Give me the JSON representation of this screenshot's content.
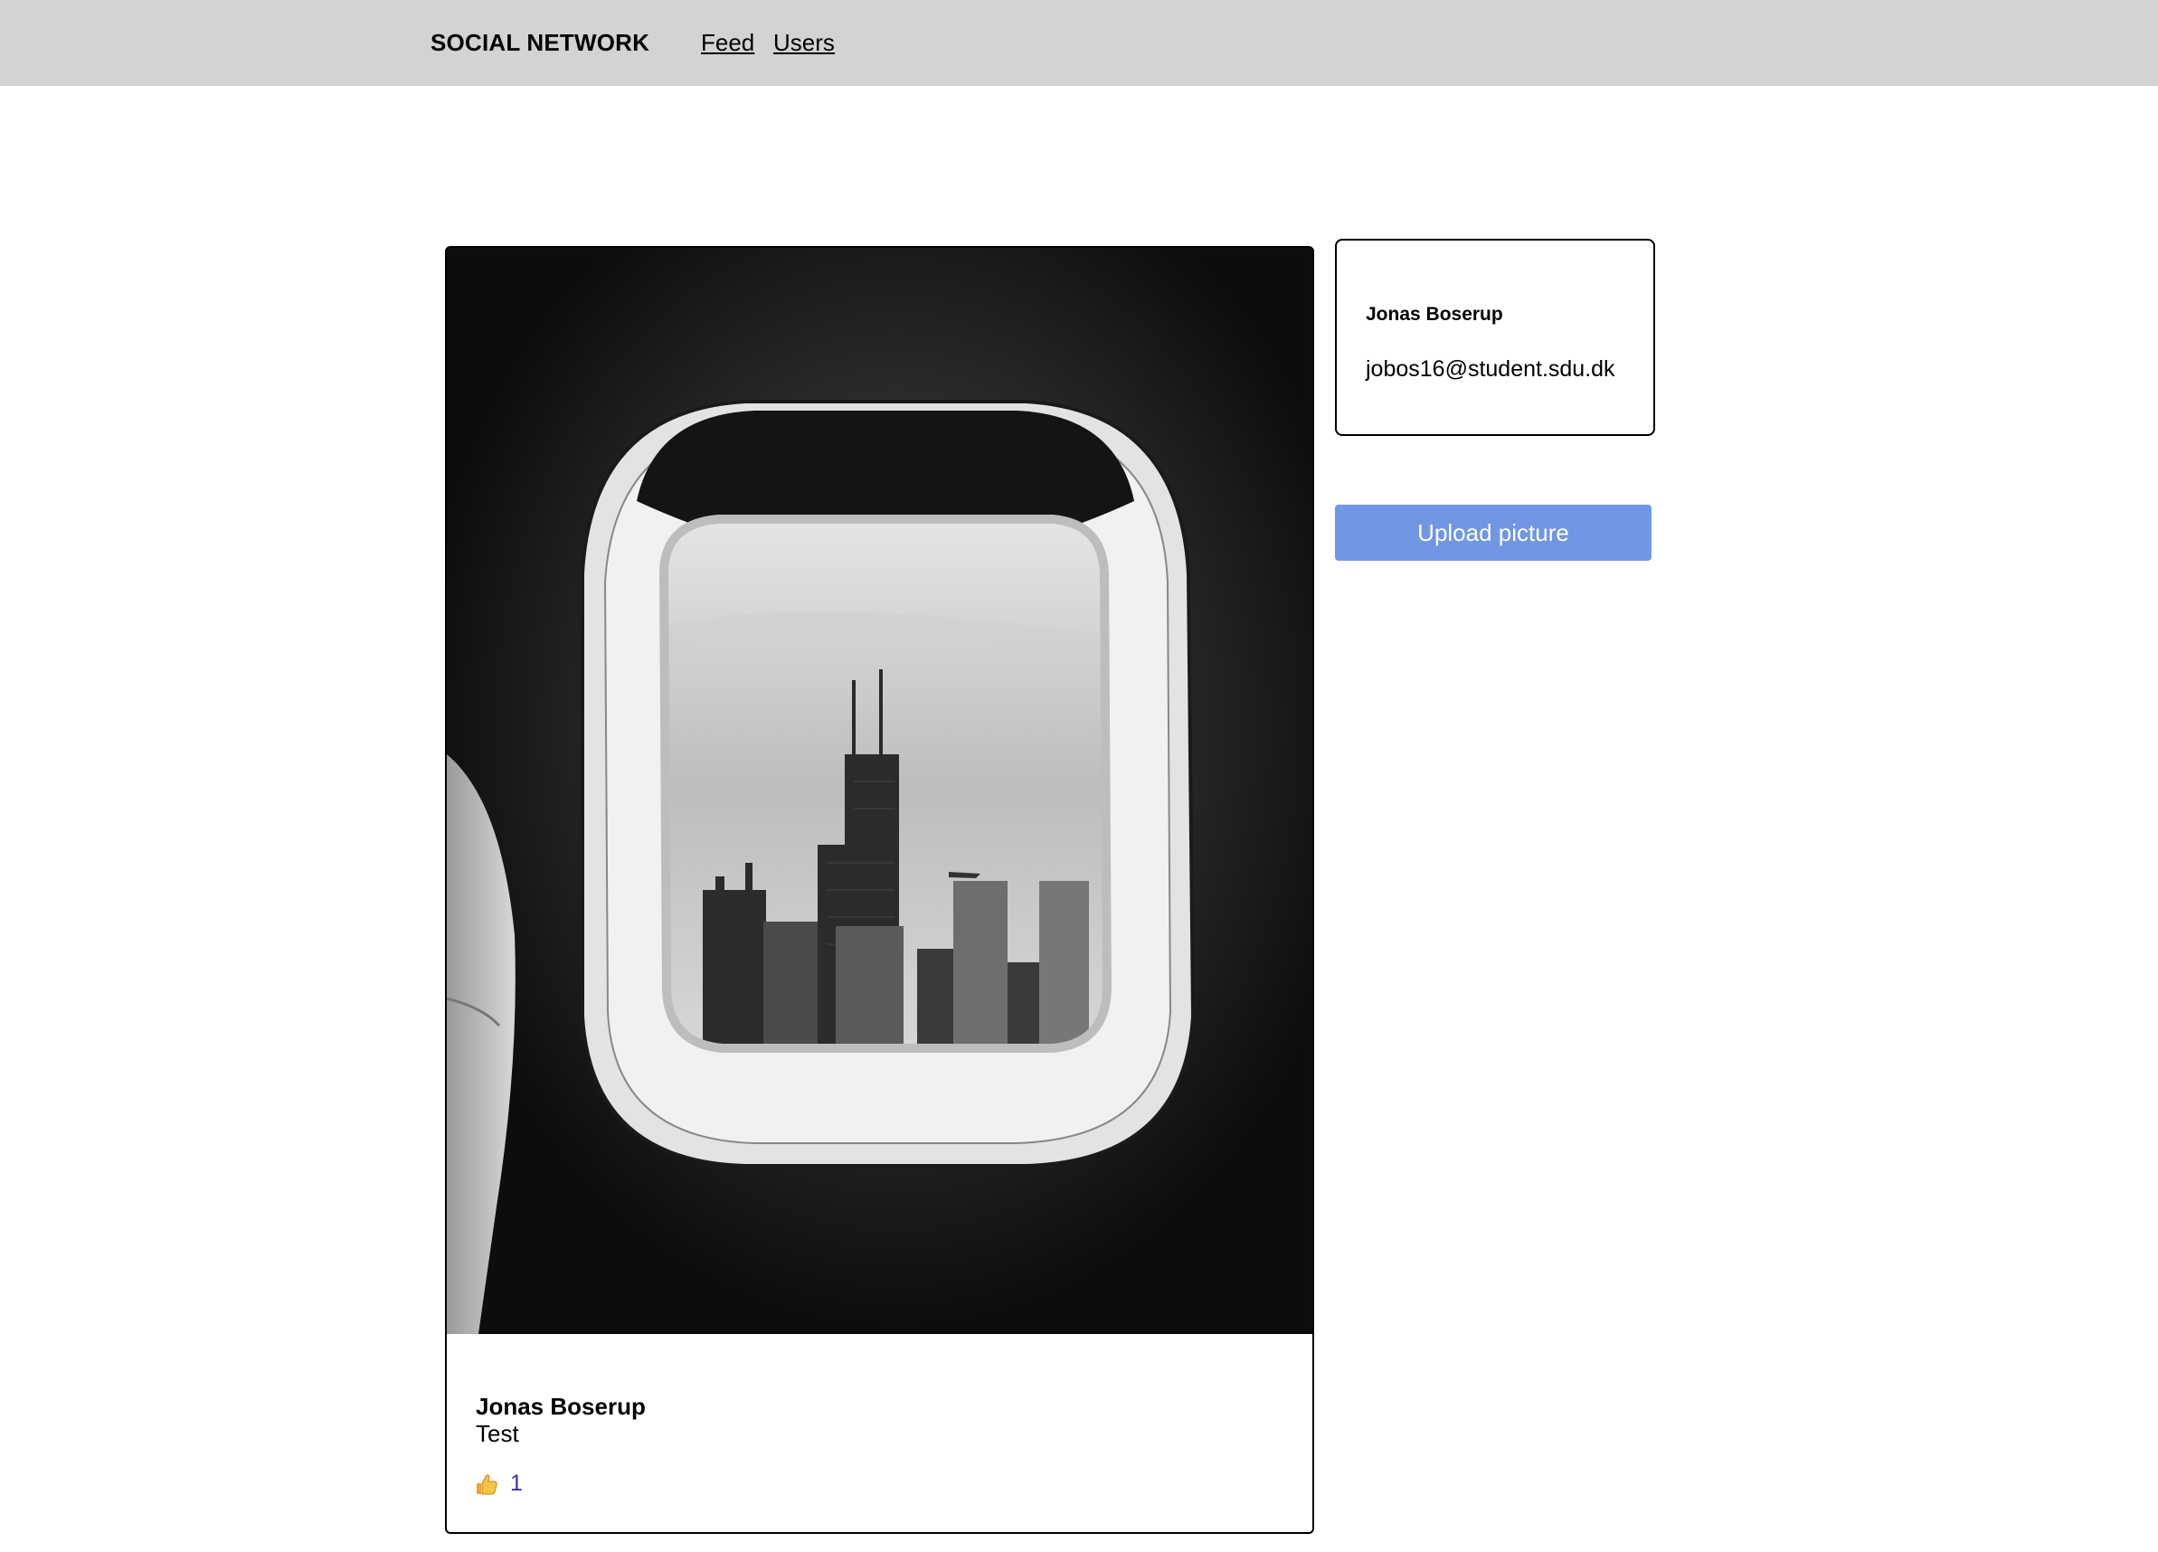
{
  "navbar": {
    "brand": "SOCIAL NETWORK",
    "links": [
      {
        "label": "Feed"
      },
      {
        "label": "Users"
      }
    ]
  },
  "post": {
    "image_description_icon": "airplane-window-photo",
    "author": "Jonas Boserup",
    "caption": "Test",
    "like_icon": "thumbs-up-icon",
    "likes": "1"
  },
  "profile": {
    "name": "Jonas Boserup",
    "email": "jobos16@student.sdu.dk"
  },
  "upload": {
    "label": "Upload picture"
  },
  "colors": {
    "navbar_bg": "#d3d3d3",
    "upload_button": "#7096e4",
    "like_count": "#4b2aa8"
  }
}
